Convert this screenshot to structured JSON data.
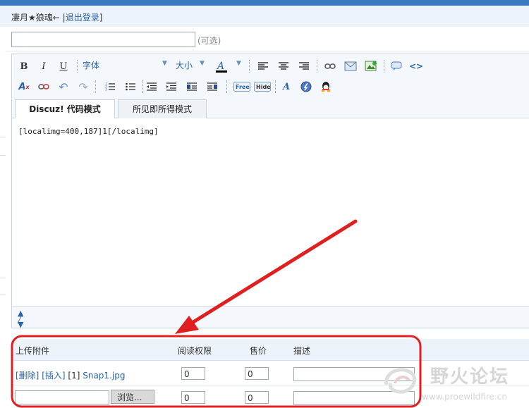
{
  "header": {
    "username": "凄月★狼魂",
    "separator": "← |",
    "logout_label": "退出登录",
    "close_bracket": "]"
  },
  "subject": {
    "value": "",
    "optional_label": "(可选)"
  },
  "toolbar": {
    "font_label": "字体",
    "size_label": "大小",
    "bold": "B",
    "italic": "I",
    "underline": "U"
  },
  "tabs": [
    {
      "label": "Discuz! 代码模式",
      "active": true
    },
    {
      "label": "所见即所得模式",
      "active": false
    }
  ],
  "editor": {
    "content": "[localimg=400,187]1[/localimg]"
  },
  "attachments": {
    "headers": {
      "upload": "上传附件",
      "permission": "阅读权限",
      "price": "售价",
      "description": "描述"
    },
    "rows": [
      {
        "delete_label": "[删除]",
        "insert_label": "[插入]",
        "index": "[1]",
        "filename": "Snap1.jpg",
        "permission": "0",
        "price": "0",
        "description": ""
      }
    ],
    "new_row": {
      "browse_label": "浏览...",
      "permission": "0",
      "price": "0"
    }
  },
  "watermark": {
    "title": "野火论坛",
    "url": "www.proewildfire.cn"
  },
  "colors": {
    "accent": "#2b64a8",
    "annotation_red": "#e02020",
    "header_bg": "#edf3fa"
  }
}
